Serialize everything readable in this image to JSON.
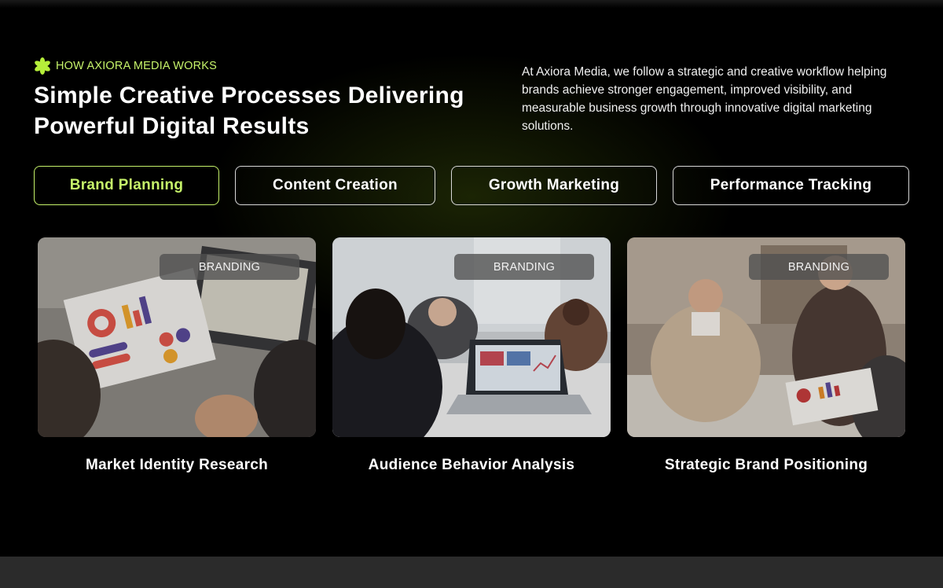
{
  "section": {
    "eyebrow": "HOW AXIORA MEDIA WORKS",
    "eyebrow_icon": "asterisk-flower-icon",
    "headline_line1": "Simple Creative Processes Delivering",
    "headline_line2": "Powerful Digital Results",
    "intro": "At Axiora Media, we follow a strategic and creative workflow helping brands achieve stronger engagement, improved visibility, and measurable business growth through innovative digital marketing solutions."
  },
  "tabs": [
    {
      "label": "Brand Planning",
      "active": true
    },
    {
      "label": "Content Creation",
      "active": false
    },
    {
      "label": "Growth Marketing",
      "active": false
    },
    {
      "label": "Performance Tracking",
      "active": false
    }
  ],
  "cards": [
    {
      "badge": "BRANDING",
      "title": "Market Identity Research",
      "image": "team-reviewing-infographic-charts-photo"
    },
    {
      "badge": "BRANDING",
      "title": "Audience Behavior Analysis",
      "image": "team-meeting-laptop-analytics-photo"
    },
    {
      "badge": "BRANDING",
      "title": "Strategic Brand Positioning",
      "image": "business-team-discussing-reports-photo"
    }
  ],
  "colors": {
    "accent": "#c6f36a",
    "background": "#000000",
    "badge_bg": "#505050",
    "footer_bar": "#2b2b2b"
  }
}
